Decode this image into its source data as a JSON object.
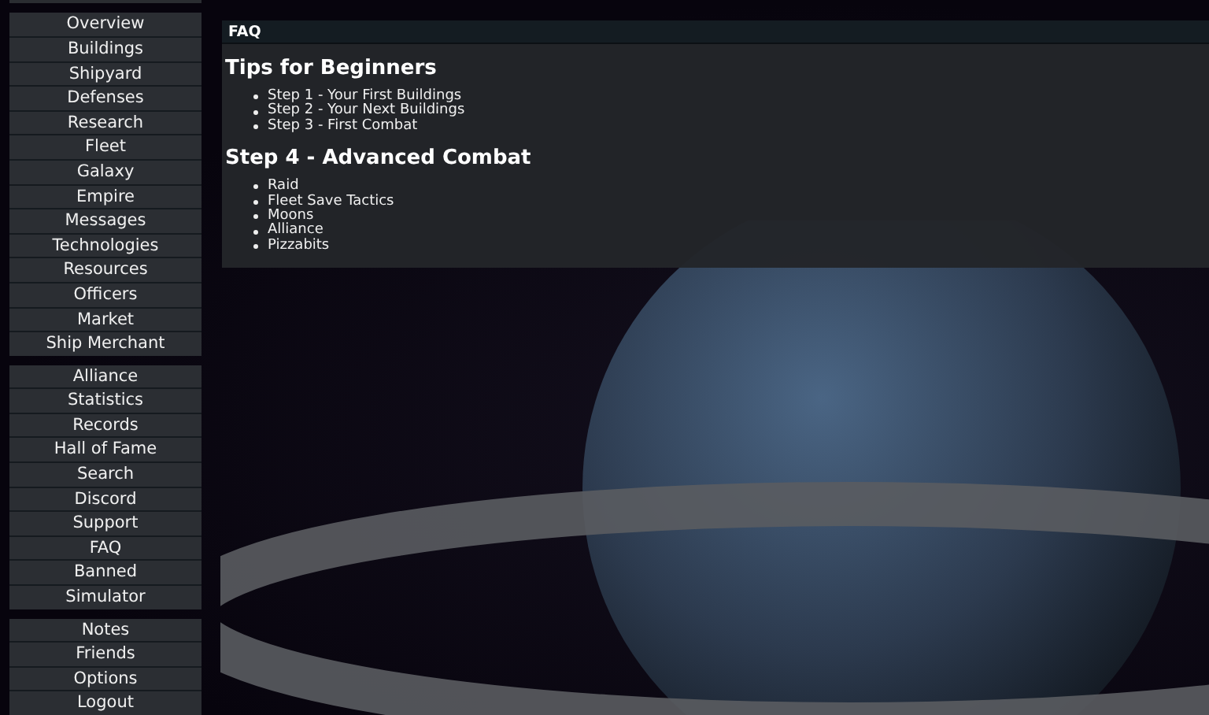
{
  "sidebar": {
    "groups": [
      {
        "items": [
          "Overview",
          "Buildings",
          "Shipyard",
          "Defenses",
          "Research",
          "Fleet",
          "Galaxy",
          "Empire",
          "Messages",
          "Technologies",
          "Resources",
          "Officers",
          "Market",
          "Ship Merchant"
        ]
      },
      {
        "items": [
          "Alliance",
          "Statistics",
          "Records",
          "Hall of Fame",
          "Search",
          "Discord",
          "Support",
          "FAQ",
          "Banned",
          "Simulator"
        ]
      },
      {
        "items": [
          "Notes",
          "Friends",
          "Options",
          "Logout"
        ]
      }
    ]
  },
  "panel": {
    "title": "FAQ",
    "sections": [
      {
        "heading": "Tips for Beginners",
        "links": [
          "Step 1 - Your First Buildings",
          "Step 2 - Your Next Buildings",
          "Step 3 - First Combat"
        ]
      },
      {
        "heading": "Step 4 - Advanced Combat",
        "links": [
          "Raid",
          "Fleet Save Tactics",
          "Moons",
          "Alliance",
          "Pizzabits"
        ]
      }
    ]
  }
}
